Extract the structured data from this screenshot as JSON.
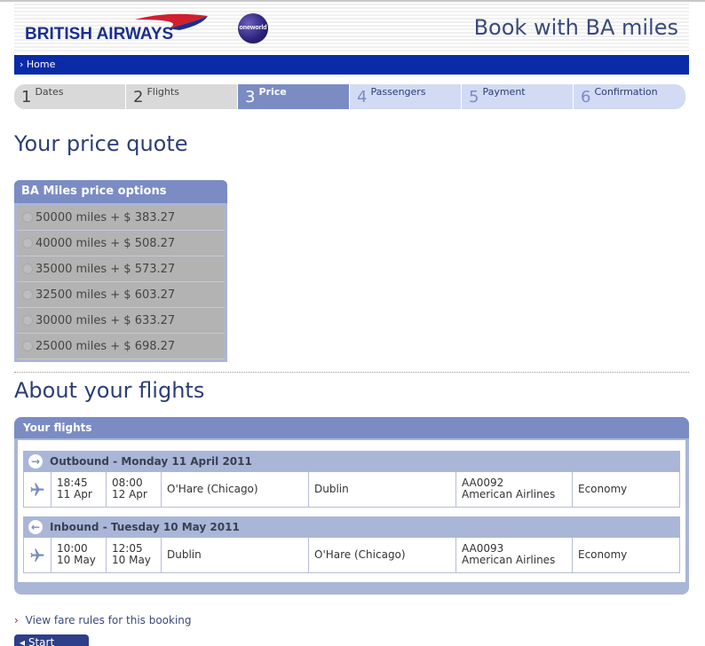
{
  "header": {
    "brand": "BRITISH AIRWAYS",
    "alliance": "oneworld",
    "page_title": "Book with BA miles"
  },
  "nav": {
    "home": "Home"
  },
  "steps": [
    {
      "num": "1",
      "label": "Dates",
      "state": "done"
    },
    {
      "num": "2",
      "label": "Flights",
      "state": "done"
    },
    {
      "num": "3",
      "label": "Price",
      "state": "active"
    },
    {
      "num": "4",
      "label": "Passengers",
      "state": "todo"
    },
    {
      "num": "5",
      "label": "Payment",
      "state": "todo"
    },
    {
      "num": "6",
      "label": "Confirmation",
      "state": "todo"
    }
  ],
  "price_quote": {
    "heading": "Your price quote",
    "box_title": "BA Miles price options",
    "options": [
      "50000 miles + $ 383.27",
      "40000 miles + $ 508.27",
      "35000 miles + $ 573.27",
      "32500 miles + $ 603.27",
      "30000 miles + $ 633.27",
      "25000 miles + $ 698.27"
    ]
  },
  "flights": {
    "heading": "About your flights",
    "panel_title": "Your flights",
    "outbound": {
      "title": "Outbound - Monday 11 April 2011",
      "dep_time": "18:45",
      "dep_date": "11 Apr",
      "arr_time": "08:00",
      "arr_date": "12 Apr",
      "from": "O'Hare (Chicago)",
      "to": "Dublin",
      "flight_no": "AA0092",
      "airline": "American Airlines",
      "cabin": "Economy"
    },
    "inbound": {
      "title": "Inbound - Tuesday 10 May 2011",
      "dep_time": "10:00",
      "dep_date": "10 May",
      "arr_time": "12:05",
      "arr_date": "10 May",
      "from": "Dublin",
      "to": "O'Hare (Chicago)",
      "flight_no": "AA0093",
      "airline": "American Airlines",
      "cabin": "Economy"
    }
  },
  "links": {
    "fare_rules": "View fare rules for this booking",
    "start_again": "Start again"
  }
}
